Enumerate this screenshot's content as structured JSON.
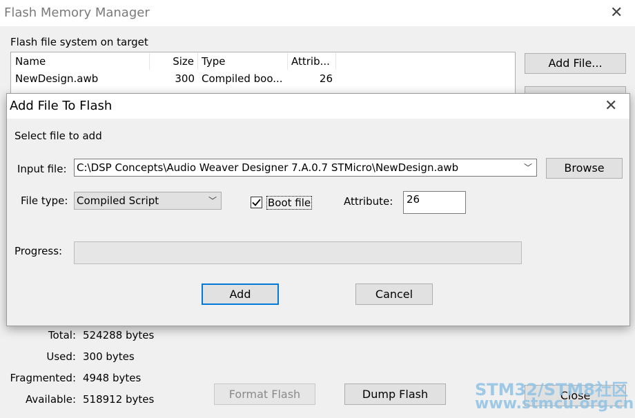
{
  "main_window": {
    "title": "Flash Memory Manager",
    "section_label": "Flash file system on target",
    "columns": [
      "Name",
      "Size",
      "Type",
      "Attrib..."
    ],
    "rows": [
      {
        "name": "NewDesign.awb",
        "size": "300",
        "type": "Compiled boo...",
        "attrib": "26"
      }
    ],
    "add_file_label": "Add File...",
    "stats": {
      "total_label": "Total:",
      "total_value": "524288 bytes",
      "used_label": "Used:",
      "used_value": "300 bytes",
      "fragmented_label": "Fragmented:",
      "fragmented_value": "4948 bytes",
      "available_label": "Available:",
      "available_value": "518912 bytes"
    },
    "format_flash_label": "Format Flash",
    "dump_flash_label": "Dump Flash",
    "close_label": "Close"
  },
  "dialog": {
    "title": "Add File To Flash",
    "prompt": "Select file to add",
    "input_file_label": "Input file:",
    "input_file_value": "C:\\DSP Concepts\\Audio Weaver Designer 7.A.0.7 STMicro\\NewDesign.awb",
    "browse_label": "Browse",
    "file_type_label": "File type:",
    "file_type_value": "Compiled Script",
    "boot_file_label": "Boot file",
    "boot_file_checked": true,
    "attribute_label": "Attribute:",
    "attribute_value": "26",
    "progress_label": "Progress:",
    "progress_value": 0,
    "add_label": "Add",
    "cancel_label": "Cancel"
  },
  "watermark": {
    "line1": "STM32/STM8社区",
    "line2": "www.stmcu.org.cn"
  },
  "icons": {
    "close": "close-icon",
    "chevron": "chevron-down-icon",
    "check": "checkmark-icon"
  }
}
